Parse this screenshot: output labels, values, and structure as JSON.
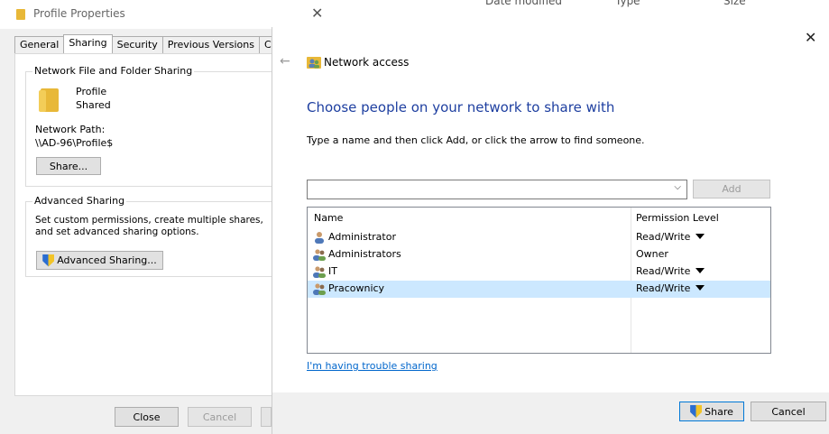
{
  "background": {
    "col_date": "Date modified",
    "col_type": "Type",
    "col_size": "Size"
  },
  "properties": {
    "title": "Profile Properties",
    "tabs": [
      "General",
      "Sharing",
      "Security",
      "Previous Versions",
      "Custom"
    ],
    "active_tab": "Sharing",
    "network_sharing": {
      "group_label": "Network File and Folder Sharing",
      "folder_name": "Profile",
      "folder_status": "Shared",
      "path_label": "Network Path:",
      "path_value": "\\\\AD-96\\Profile$",
      "share_button": "Share..."
    },
    "advanced_sharing": {
      "group_label": "Advanced Sharing",
      "description": "Set custom permissions, create multiple shares, and set advanced sharing options.",
      "button": "Advanced Sharing..."
    },
    "buttons": {
      "close": "Close",
      "cancel": "Cancel"
    }
  },
  "network_access": {
    "title": "Network access",
    "heading": "Choose people on your network to share with",
    "instruction": "Type a name and then click Add, or click the arrow to find someone.",
    "input_value": "",
    "add_button": "Add",
    "columns": {
      "name": "Name",
      "permission": "Permission Level"
    },
    "rows": [
      {
        "name": "Administrator",
        "permission": "Read/Write",
        "dropdown": true,
        "icon": "user-icon",
        "selected": false
      },
      {
        "name": "Administrators",
        "permission": "Owner",
        "dropdown": false,
        "icon": "group-icon",
        "selected": false
      },
      {
        "name": "IT",
        "permission": "Read/Write",
        "dropdown": true,
        "icon": "group-icon",
        "selected": false
      },
      {
        "name": "Pracownicy",
        "permission": "Read/Write",
        "dropdown": true,
        "icon": "group-icon",
        "selected": true
      }
    ],
    "trouble_link": "I'm having trouble sharing",
    "share_button": "Share",
    "cancel_button": "Cancel"
  },
  "colors": {
    "heading": "#1e3fa0",
    "link": "#0066cc",
    "selection": "#cce8ff"
  }
}
